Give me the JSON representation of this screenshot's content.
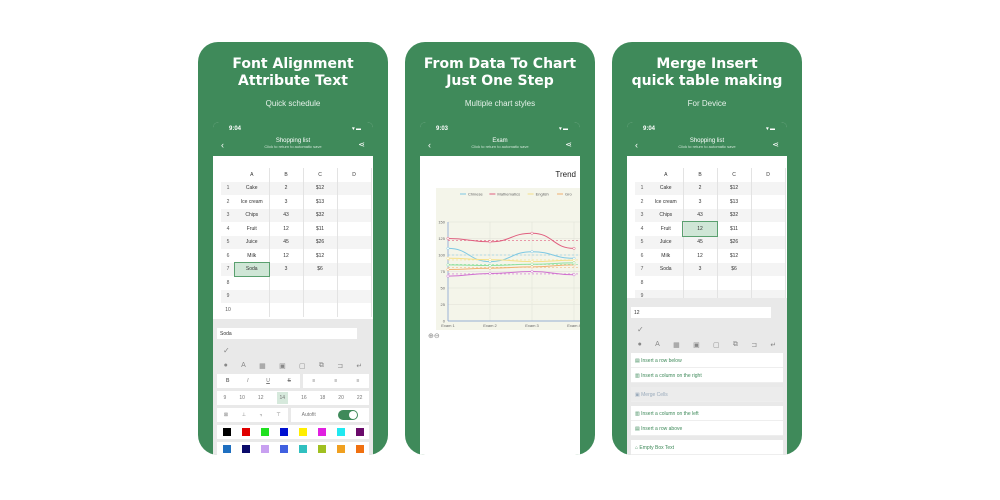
{
  "colors": {
    "brand": "#3f8a5a"
  },
  "cards": [
    {
      "title1": "Font Alignment",
      "title2": "Attribute Text",
      "subtitle": "Quick schedule"
    },
    {
      "title1": "From Data To Chart",
      "title2": "Just One Step",
      "subtitle": "Multiple chart styles"
    },
    {
      "title1": "Merge  Insert",
      "title2": "quick table making",
      "subtitle": "For Device"
    }
  ],
  "phone1": {
    "time": "9:04",
    "nav_title": "Shopping list",
    "nav_sub": "Click to return to automatic save",
    "input": "Soda",
    "font_sizes": [
      "9",
      "10",
      "12",
      "14",
      "16",
      "18",
      "20",
      "22"
    ],
    "autofit": "Autofit"
  },
  "phone2": {
    "time": "9:03",
    "nav_title": "Exam",
    "nav_sub": "Click to return to automatic save"
  },
  "phone3": {
    "time": "9:04",
    "nav_title": "Shopping list",
    "nav_sub": "Click to return to automatic save",
    "input": "12",
    "menu": [
      "Insert a row below",
      "Insert a column on the right",
      "Merge Cells",
      "Insert a column on the left",
      "Insert a row above",
      "Empty Box Text"
    ]
  },
  "table": {
    "headers": [
      "A",
      "B",
      "C",
      "D"
    ],
    "rows": [
      [
        "1",
        "Cake",
        "2",
        "$12"
      ],
      [
        "2",
        "Ice cream",
        "3",
        "$13"
      ],
      [
        "3",
        "Chips",
        "43",
        "$32"
      ],
      [
        "4",
        "Fruit",
        "12",
        "$11"
      ],
      [
        "5",
        "Juice",
        "45",
        "$26"
      ],
      [
        "6",
        "Milk",
        "12",
        "$12"
      ],
      [
        "7",
        "Soda",
        "3",
        "$6"
      ],
      [
        "8",
        "",
        "",
        ""
      ],
      [
        "9",
        "",
        "",
        ""
      ],
      [
        "10",
        "",
        "",
        ""
      ]
    ]
  },
  "swatches1": [
    "#000000",
    "#e00000",
    "#20e020",
    "#0010d0",
    "#ffee00",
    "#e020e0",
    "#20e8f0",
    "#6a0a6a"
  ],
  "swatches2": [
    "#1f6fc0",
    "#0a0a6a",
    "#c8a0f0",
    "#4060e0",
    "#30c0c0",
    "#a0c020",
    "#f0a020",
    "#f07010"
  ],
  "chart_data": {
    "type": "line",
    "title": "Trend",
    "categories": [
      "Exam 1",
      "Exam 2",
      "Exam 3",
      "Exam 4"
    ],
    "ylim": [
      0,
      150
    ],
    "yticks": [
      0,
      25,
      50,
      75,
      100,
      125,
      150
    ],
    "grid": true,
    "legend": "top",
    "series": [
      {
        "name": "Chinese",
        "color": "#7ec8e3",
        "values": [
          110,
          90,
          105,
          95
        ]
      },
      {
        "name": "Mathematics",
        "color": "#e06080",
        "values": [
          125,
          120,
          133,
          110
        ]
      },
      {
        "name": "English",
        "color": "#f5e08a",
        "values": [
          95,
          93,
          90,
          92
        ]
      },
      {
        "name": "Gro",
        "color": "#f0b070",
        "values": [
          78,
          80,
          82,
          85
        ]
      },
      {
        "color": "#d070d0",
        "values": [
          68,
          72,
          75,
          70
        ]
      },
      {
        "color": "#90e0a0",
        "values": [
          85,
          84,
          86,
          88
        ]
      }
    ]
  }
}
